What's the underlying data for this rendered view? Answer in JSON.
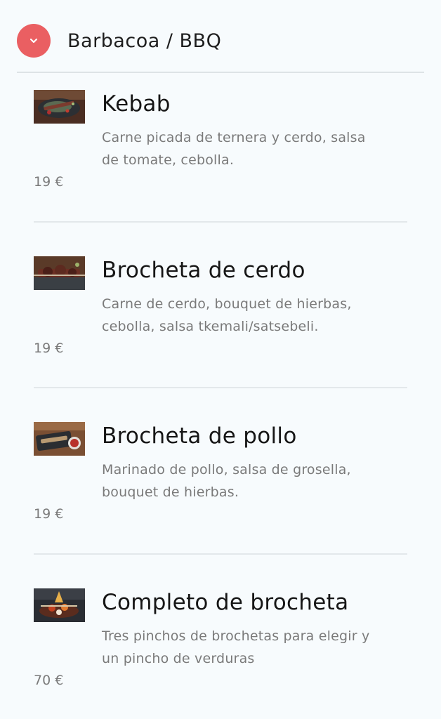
{
  "section": {
    "title": "Barbacoa / BBQ",
    "toggle_icon": "chevron-down-icon",
    "accent_color": "#ea5f62"
  },
  "items": [
    {
      "name": "Kebab",
      "description": "Carne picada de ternera y cerdo, salsa de tomate, cebolla.",
      "price": "19 €",
      "image": "kebab-skewers-photo"
    },
    {
      "name": "Brocheta de cerdo",
      "description": "Carne de cerdo, bouquet de hierbas, cebolla, salsa tkemali/satsebeli.",
      "price": "19 €",
      "image": "pork-skewer-photo"
    },
    {
      "name": "Brocheta de pollo",
      "description": "Marinado de pollo, salsa de grosella, bouquet de hierbas.",
      "price": "19 €",
      "image": "chicken-skewer-photo"
    },
    {
      "name": "Completo de brocheta",
      "description": "Tres pinchos de brochetas para elegir y un pincho de verduras",
      "price": "70 €",
      "image": "skewer-platter-photo"
    }
  ]
}
